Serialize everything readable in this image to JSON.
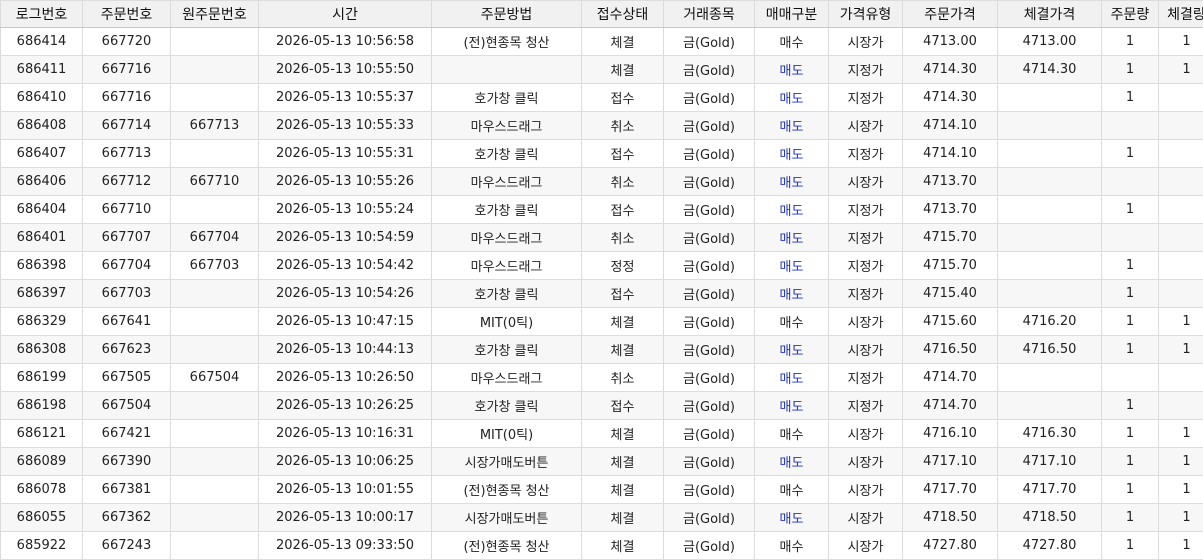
{
  "columns": [
    "로그번호",
    "주문번호",
    "원주문번호",
    "시간",
    "주문방법",
    "접수상태",
    "거래종목",
    "매매구분",
    "가격유형",
    "주문가격",
    "체결가격",
    "주문량",
    "체결량"
  ],
  "colors": {
    "sell": "#1f33c6",
    "header_bg": "#f1f1f1",
    "stripe_bg": "#f7f7f7"
  },
  "rows": [
    {
      "log": "686414",
      "order": "667720",
      "orig": "",
      "time": "2026-05-13 10:56:58",
      "method": "(전)현종목 청산",
      "status": "체결",
      "item": "금(Gold)",
      "side": "매수",
      "ptype": "시장가",
      "oprice": "4713.00",
      "fprice": "4713.00",
      "oqty": "1",
      "fqty": "1"
    },
    {
      "log": "686411",
      "order": "667716",
      "orig": "",
      "time": "2026-05-13 10:55:50",
      "method": "",
      "status": "체결",
      "item": "금(Gold)",
      "side": "매도",
      "ptype": "지정가",
      "oprice": "4714.30",
      "fprice": "4714.30",
      "oqty": "1",
      "fqty": "1"
    },
    {
      "log": "686410",
      "order": "667716",
      "orig": "",
      "time": "2026-05-13 10:55:37",
      "method": "호가창 클릭",
      "status": "접수",
      "item": "금(Gold)",
      "side": "매도",
      "ptype": "지정가",
      "oprice": "4714.30",
      "fprice": "",
      "oqty": "1",
      "fqty": ""
    },
    {
      "log": "686408",
      "order": "667714",
      "orig": "667713",
      "time": "2026-05-13 10:55:33",
      "method": "마우스드래그",
      "status": "취소",
      "item": "금(Gold)",
      "side": "매도",
      "ptype": "시장가",
      "oprice": "4714.10",
      "fprice": "",
      "oqty": "",
      "fqty": ""
    },
    {
      "log": "686407",
      "order": "667713",
      "orig": "",
      "time": "2026-05-13 10:55:31",
      "method": "호가창 클릭",
      "status": "접수",
      "item": "금(Gold)",
      "side": "매도",
      "ptype": "지정가",
      "oprice": "4714.10",
      "fprice": "",
      "oqty": "1",
      "fqty": ""
    },
    {
      "log": "686406",
      "order": "667712",
      "orig": "667710",
      "time": "2026-05-13 10:55:26",
      "method": "마우스드래그",
      "status": "취소",
      "item": "금(Gold)",
      "side": "매도",
      "ptype": "시장가",
      "oprice": "4713.70",
      "fprice": "",
      "oqty": "",
      "fqty": ""
    },
    {
      "log": "686404",
      "order": "667710",
      "orig": "",
      "time": "2026-05-13 10:55:24",
      "method": "호가창 클릭",
      "status": "접수",
      "item": "금(Gold)",
      "side": "매도",
      "ptype": "지정가",
      "oprice": "4713.70",
      "fprice": "",
      "oqty": "1",
      "fqty": ""
    },
    {
      "log": "686401",
      "order": "667707",
      "orig": "667704",
      "time": "2026-05-13 10:54:59",
      "method": "마우스드래그",
      "status": "취소",
      "item": "금(Gold)",
      "side": "매도",
      "ptype": "지정가",
      "oprice": "4715.70",
      "fprice": "",
      "oqty": "",
      "fqty": ""
    },
    {
      "log": "686398",
      "order": "667704",
      "orig": "667703",
      "time": "2026-05-13 10:54:42",
      "method": "마우스드래그",
      "status": "정정",
      "item": "금(Gold)",
      "side": "매도",
      "ptype": "지정가",
      "oprice": "4715.70",
      "fprice": "",
      "oqty": "1",
      "fqty": ""
    },
    {
      "log": "686397",
      "order": "667703",
      "orig": "",
      "time": "2026-05-13 10:54:26",
      "method": "호가창 클릭",
      "status": "접수",
      "item": "금(Gold)",
      "side": "매도",
      "ptype": "지정가",
      "oprice": "4715.40",
      "fprice": "",
      "oqty": "1",
      "fqty": ""
    },
    {
      "log": "686329",
      "order": "667641",
      "orig": "",
      "time": "2026-05-13 10:47:15",
      "method": "MIT(0틱)",
      "status": "체결",
      "item": "금(Gold)",
      "side": "매수",
      "ptype": "시장가",
      "oprice": "4715.60",
      "fprice": "4716.20",
      "oqty": "1",
      "fqty": "1"
    },
    {
      "log": "686308",
      "order": "667623",
      "orig": "",
      "time": "2026-05-13 10:44:13",
      "method": "호가창 클릭",
      "status": "체결",
      "item": "금(Gold)",
      "side": "매도",
      "ptype": "시장가",
      "oprice": "4716.50",
      "fprice": "4716.50",
      "oqty": "1",
      "fqty": "1"
    },
    {
      "log": "686199",
      "order": "667505",
      "orig": "667504",
      "time": "2026-05-13 10:26:50",
      "method": "마우스드래그",
      "status": "취소",
      "item": "금(Gold)",
      "side": "매도",
      "ptype": "지정가",
      "oprice": "4714.70",
      "fprice": "",
      "oqty": "",
      "fqty": ""
    },
    {
      "log": "686198",
      "order": "667504",
      "orig": "",
      "time": "2026-05-13 10:26:25",
      "method": "호가창 클릭",
      "status": "접수",
      "item": "금(Gold)",
      "side": "매도",
      "ptype": "지정가",
      "oprice": "4714.70",
      "fprice": "",
      "oqty": "1",
      "fqty": ""
    },
    {
      "log": "686121",
      "order": "667421",
      "orig": "",
      "time": "2026-05-13 10:16:31",
      "method": "MIT(0틱)",
      "status": "체결",
      "item": "금(Gold)",
      "side": "매수",
      "ptype": "시장가",
      "oprice": "4716.10",
      "fprice": "4716.30",
      "oqty": "1",
      "fqty": "1"
    },
    {
      "log": "686089",
      "order": "667390",
      "orig": "",
      "time": "2026-05-13 10:06:25",
      "method": "시장가매도버튼",
      "status": "체결",
      "item": "금(Gold)",
      "side": "매도",
      "ptype": "시장가",
      "oprice": "4717.10",
      "fprice": "4717.10",
      "oqty": "1",
      "fqty": "1"
    },
    {
      "log": "686078",
      "order": "667381",
      "orig": "",
      "time": "2026-05-13 10:01:55",
      "method": "(전)현종목 청산",
      "status": "체결",
      "item": "금(Gold)",
      "side": "매수",
      "ptype": "시장가",
      "oprice": "4717.70",
      "fprice": "4717.70",
      "oqty": "1",
      "fqty": "1"
    },
    {
      "log": "686055",
      "order": "667362",
      "orig": "",
      "time": "2026-05-13 10:00:17",
      "method": "시장가매도버튼",
      "status": "체결",
      "item": "금(Gold)",
      "side": "매도",
      "ptype": "시장가",
      "oprice": "4718.50",
      "fprice": "4718.50",
      "oqty": "1",
      "fqty": "1"
    },
    {
      "log": "685922",
      "order": "667243",
      "orig": "",
      "time": "2026-05-13 09:33:50",
      "method": "(전)현종목 청산",
      "status": "체결",
      "item": "금(Gold)",
      "side": "매수",
      "ptype": "시장가",
      "oprice": "4727.80",
      "fprice": "4727.80",
      "oqty": "1",
      "fqty": "1"
    }
  ]
}
